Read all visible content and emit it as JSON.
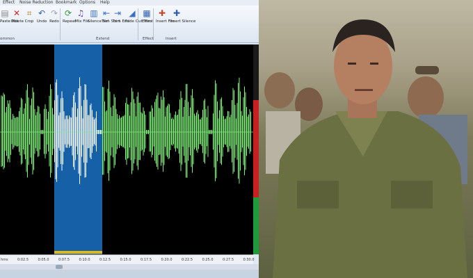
{
  "menu": [
    "Effect",
    "Noise Reduction",
    "Bookmark",
    "Options",
    "Help"
  ],
  "ribbon": {
    "tools": [
      {
        "label": "Paste Mix",
        "icon": "paste-mix-icon",
        "glyph": "▤",
        "color": "#8a8a8a"
      },
      {
        "label": "Delete",
        "icon": "delete-icon",
        "glyph": "✕",
        "color": "#d62828"
      },
      {
        "label": "Crop",
        "icon": "crop-icon",
        "glyph": "⌗",
        "color": "#b07a1e"
      },
      {
        "label": "Undo",
        "icon": "undo-icon",
        "glyph": "↶",
        "color": "#2f5fb3"
      },
      {
        "label": "Redo",
        "icon": "redo-icon",
        "glyph": "↷",
        "color": "#9aa4b4"
      },
      {
        "label": "Repeat",
        "icon": "repeat-icon",
        "glyph": "⟳",
        "color": "#2e9a3c"
      },
      {
        "label": "Mix File",
        "icon": "mix-file-icon",
        "glyph": "♫",
        "color": "#6a3fa8"
      },
      {
        "label": "Silence Sel",
        "icon": "silence-icon",
        "glyph": "▥",
        "color": "#3a6fc4"
      },
      {
        "label": "Trim Start",
        "icon": "trim-start-icon",
        "glyph": "⇤",
        "color": "#3a6fc4"
      },
      {
        "label": "Trim End",
        "icon": "trim-end-icon",
        "glyph": "⇥",
        "color": "#3a6fc4"
      },
      {
        "label": "Fade Out Trim",
        "icon": "fade-out-icon",
        "glyph": "◢",
        "color": "#3a6fc4"
      },
      {
        "label": "Effect",
        "icon": "effect-icon",
        "glyph": "▦",
        "color": "#2f5fb3"
      },
      {
        "label": "Insert File",
        "icon": "insert-file-icon",
        "glyph": "✚",
        "color": "#c44a2a"
      },
      {
        "label": "Insert Silence",
        "icon": "insert-silence-icon",
        "glyph": "✚",
        "color": "#2f5fb3"
      }
    ],
    "groups": [
      "ommon",
      "Extend",
      "Effect",
      "Insert"
    ]
  },
  "timeline": [
    "hms",
    "0:02.5",
    "0:05.0",
    "0:07.5",
    "0:10.0",
    "0:12.5",
    "0:15.0",
    "0:17.5",
    "0:20.0",
    "0:22.5",
    "0:25.0",
    "0:27.5",
    "0:30.0"
  ],
  "colors": {
    "wave": "#7ff07a",
    "selected_wave": "#ffffff",
    "selection": "#1660a8",
    "selection_marker": "#e5b80f"
  }
}
